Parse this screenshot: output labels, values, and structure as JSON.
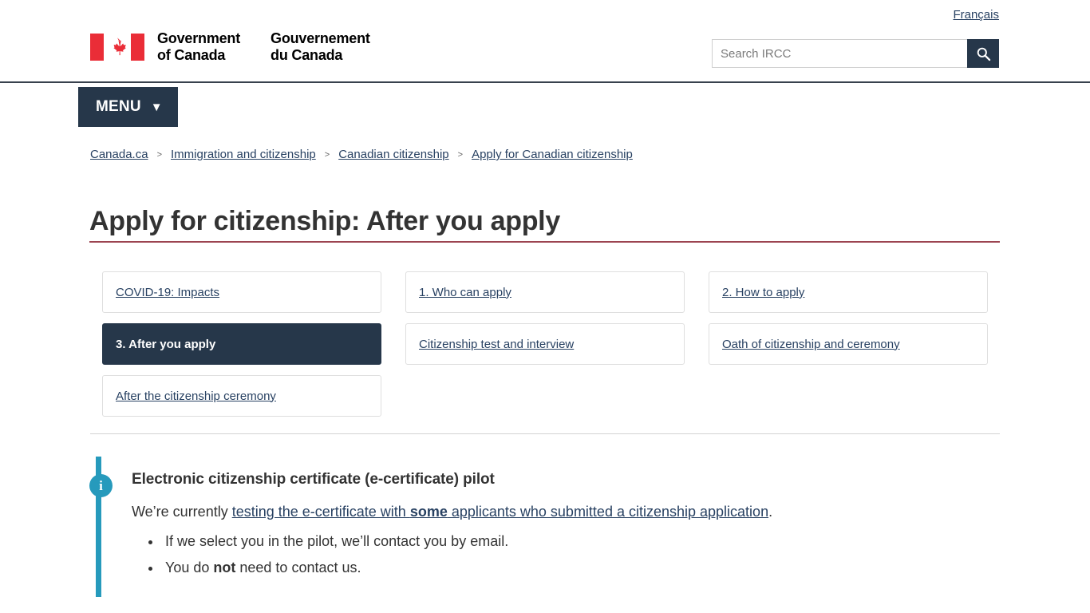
{
  "header": {
    "lang_link": "Français",
    "brand_en": "Government\nof Canada",
    "brand_fr": "Gouvernement\ndu Canada",
    "flag_icon": "canada-flag-icon",
    "search": {
      "placeholder": "Search IRCC",
      "value": "",
      "button_icon": "search-icon"
    },
    "menu": {
      "label": "MENU",
      "caret_icon": "chevron-down-icon"
    }
  },
  "breadcrumb": {
    "separator": ">",
    "items": [
      {
        "label": "Canada.ca"
      },
      {
        "label": "Immigration and citizenship"
      },
      {
        "label": "Canadian citizenship"
      },
      {
        "label": "Apply for Canadian citizenship"
      }
    ]
  },
  "main": {
    "page_title": "Apply for citizenship: After you apply",
    "tabs": [
      {
        "label": "COVID-19: Impacts",
        "active": false
      },
      {
        "label": "1. Who can apply",
        "active": false
      },
      {
        "label": "2. How to apply",
        "active": false
      },
      {
        "label": "3. After you apply",
        "active": true
      },
      {
        "label": "Citizenship test and interview",
        "active": false
      },
      {
        "label": "Oath of citizenship and ceremony",
        "active": false
      },
      {
        "label": "After the citizenship ceremony",
        "active": false
      }
    ],
    "callout": {
      "icon": "info-icon",
      "title": "Electronic citizenship certificate (e-certificate) pilot",
      "paragraph_prefix": "We’re currently ",
      "link_part1": "testing the e-certificate with ",
      "link_bold": "some",
      "link_part2": " applicants who submitted a citizenship application",
      "paragraph_suffix": ".",
      "bullets": [
        {
          "prefix": "If we select you in the pilot, we’ll contact you by email.",
          "bold": "",
          "suffix": ""
        },
        {
          "prefix": "You do ",
          "bold": "not",
          "suffix": " need to contact us."
        }
      ]
    }
  },
  "colors": {
    "navy": "#26374a",
    "link": "#284162",
    "flag_red": "#ea2d37",
    "title_rule": "#8b2331",
    "callout_teal": "#269abc",
    "divider": "#d3d3d3"
  }
}
